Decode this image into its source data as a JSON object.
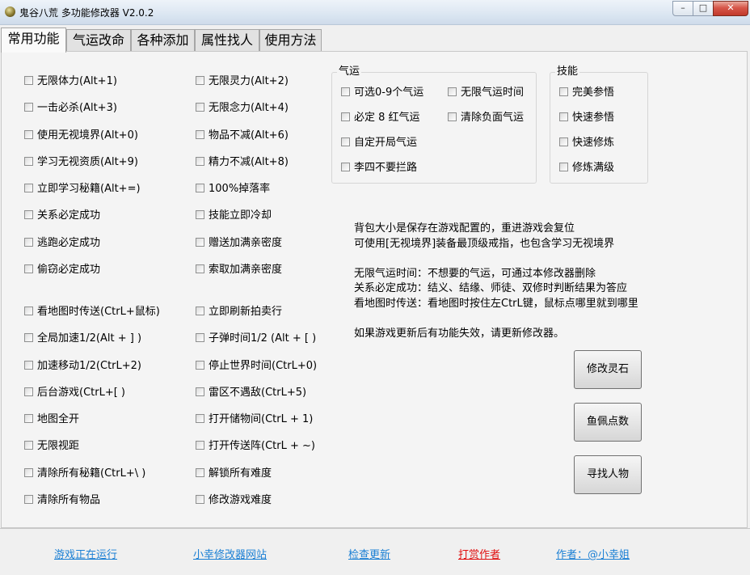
{
  "window": {
    "title": "鬼谷八荒 多功能修改器 V2.0.2",
    "buttons": {
      "min": "–",
      "max": "□",
      "close": "✕"
    }
  },
  "tabs": [
    "常用功能",
    "气运改命",
    "各种添加",
    "属性找人",
    "使用方法"
  ],
  "left_col": [
    "无限体力(Alt+1)",
    "一击必杀(Alt+3)",
    "使用无视境界(Alt+0)",
    "学习无视资质(Alt+9)",
    "立即学习秘籍(Alt+=)",
    "关系必定成功",
    "逃跑必定成功",
    "偷窃必定成功",
    "看地图时传送(CtrL+鼠标)",
    "全局加速1/2(Alt + ] )",
    "加速移动1/2(CtrL+2)",
    "后台游戏(CtrL+[ )",
    "地图全开",
    "无限视距",
    "清除所有秘籍(CtrL+\\ )",
    "清除所有物品"
  ],
  "mid_col": [
    "无限灵力(Alt+2)",
    "无限念力(Alt+4)",
    "物品不减(Alt+6)",
    "精力不减(Alt+8)",
    "100%掉落率",
    "技能立即冷却",
    "赠送加满亲密度",
    "索取加满亲密度",
    "立即刷新拍卖行",
    "子弹时间1/2 (Alt + [ )",
    "停止世界时间(CtrL+0)",
    "雷区不遇敌(CtrL+5)",
    "打开储物间(CtrL + 1)",
    "打开传送阵(CtrL + ~)",
    "解锁所有难度",
    "修改游戏难度"
  ],
  "qiyun": {
    "title": "气运",
    "items": [
      "可选0-9个气运",
      "无限气运时间",
      "必定 8 红气运",
      "清除负面气运",
      "自定开局气运",
      "李四不要拦路"
    ]
  },
  "jineng": {
    "title": "技能",
    "items": [
      "完美参悟",
      "快速参悟",
      "快速修炼",
      "修炼满级"
    ]
  },
  "notes": [
    "背包大小是保存在游戏配置的，重进游戏会复位",
    "可使用[无视境界]装备最顶级戒指，也包含学习无视境界",
    "",
    "无限气运时间：不想要的气运，可通过本修改器删除",
    "关系必定成功：结义、结缘、师徒、双修时判断结果为答应",
    "看地图时传送：看地图时按住左CtrL键，鼠标点哪里就到哪里",
    "",
    "如果游戏更新后有功能失效，请更新修改器。"
  ],
  "buttons": [
    "修改灵石",
    "鱼佩点数",
    "寻找人物"
  ],
  "footer": [
    "游戏正在运行",
    "小幸修改器网站",
    "检查更新",
    "打赏作者",
    "作者：@小幸姐"
  ],
  "colors": {
    "link": "#1a7fd4",
    "link_red": "#e01010"
  }
}
